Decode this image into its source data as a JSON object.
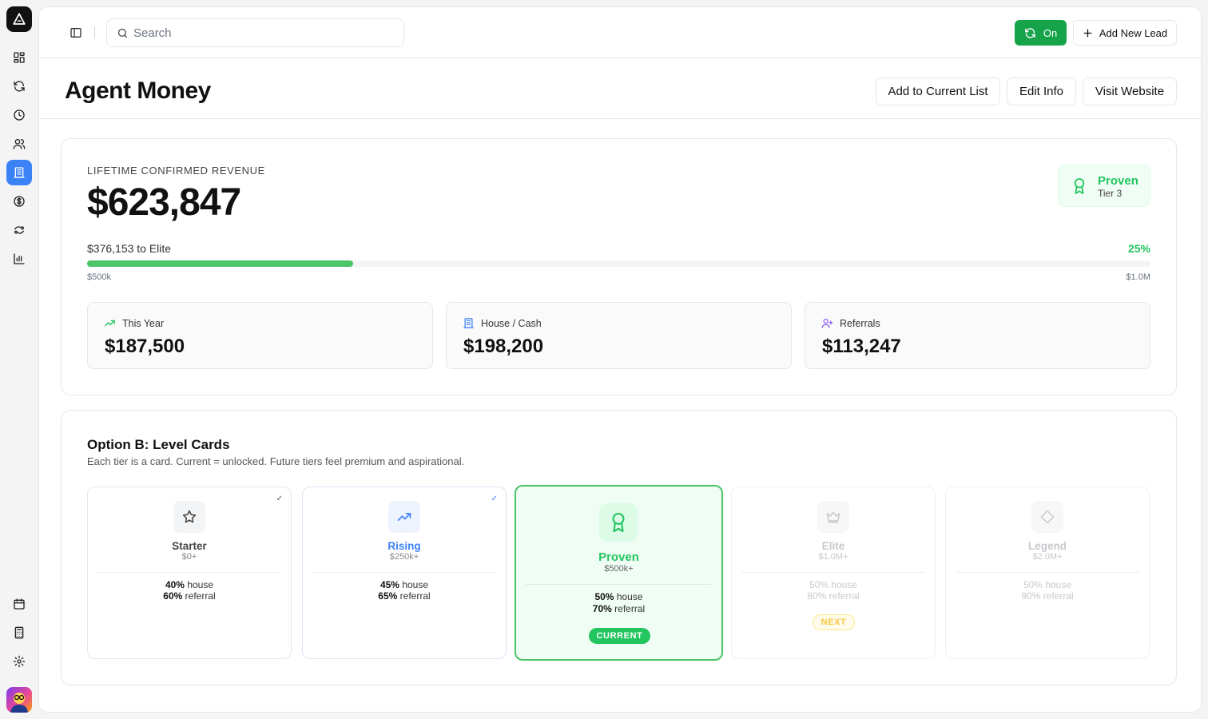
{
  "search": {
    "placeholder": "Search"
  },
  "topbar": {
    "sync_label": "On",
    "add_lead_label": "Add New Lead"
  },
  "header": {
    "title": "Agent Money",
    "buttons": [
      "Add to Current List",
      "Edit Info",
      "Visit Website"
    ]
  },
  "revenue": {
    "label": "LIFETIME CONFIRMED REVENUE",
    "amount": "$623,847",
    "tier_name": "Proven",
    "tier_level": "Tier 3",
    "progress_text": "$376,153 to Elite",
    "progress_pct_label": "25%",
    "progress_fraction": 0.25,
    "range_start": "$500k",
    "range_end": "$1.0M",
    "stats": [
      {
        "icon": "trending-up-icon",
        "label": "This Year",
        "value": "$187,500"
      },
      {
        "icon": "building-icon",
        "label": "House / Cash",
        "value": "$198,200"
      },
      {
        "icon": "user-plus-icon",
        "label": "Referrals",
        "value": "$113,247"
      }
    ]
  },
  "levels": {
    "title": "Option B: Level Cards",
    "subtitle": "Each tier is a card. Current = unlocked. Future tiers feel premium and aspirational.",
    "house_word": "house",
    "referral_word": "referral",
    "current_badge": "CURRENT",
    "next_badge": "NEXT",
    "cards": [
      {
        "name": "Starter",
        "req": "$0+",
        "house": "40%",
        "referral": "60%",
        "icon": "star-icon",
        "status": "unlocked",
        "check": "✓"
      },
      {
        "name": "Rising",
        "req": "$250k+",
        "house": "45%",
        "referral": "65%",
        "icon": "trending-up-icon",
        "status": "unlocked",
        "check": "✓"
      },
      {
        "name": "Proven",
        "req": "$500k+",
        "house": "50%",
        "referral": "70%",
        "icon": "award-icon",
        "status": "current"
      },
      {
        "name": "Elite",
        "req": "$1.0M+",
        "house": "50%",
        "referral": "80%",
        "icon": "crown-icon",
        "status": "next"
      },
      {
        "name": "Legend",
        "req": "$2.0M+",
        "house": "50%",
        "referral": "90%",
        "icon": "diamond-icon",
        "status": "locked"
      }
    ]
  },
  "colors": {
    "accent_green": "#22c55e",
    "button_green": "#16a34a",
    "active_blue": "#3b82f6",
    "rising_blue": "#3b82f6"
  }
}
